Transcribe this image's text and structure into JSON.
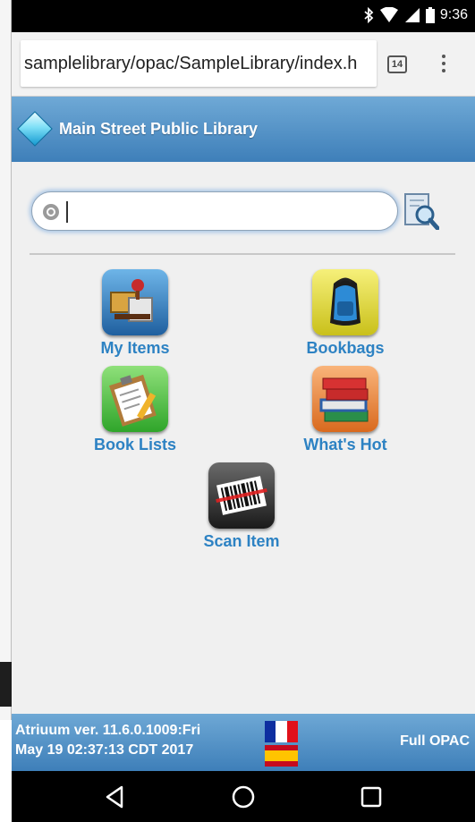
{
  "status_bar": {
    "time": "9:36",
    "icons": [
      "bluetooth-icon",
      "wifi-icon",
      "signal-icon",
      "battery-icon"
    ]
  },
  "browser": {
    "url": "samplelibrary/opac/SampleLibrary/index.h",
    "tab_count": "14"
  },
  "header": {
    "title": "Main Street Public Library"
  },
  "search": {
    "value": "",
    "placeholder": ""
  },
  "tiles": [
    {
      "label": "My Items",
      "icon": "my-items-icon"
    },
    {
      "label": "Bookbags",
      "icon": "backpack-icon"
    },
    {
      "label": "Book Lists",
      "icon": "clipboard-list-icon"
    },
    {
      "label": "What's Hot",
      "icon": "book-stack-icon"
    },
    {
      "label": "Scan Item",
      "icon": "barcode-scanner-icon"
    }
  ],
  "footer": {
    "version_line1": "Atriuum ver. 11.6.0.1009:Fri",
    "version_line2": "May 19 02:37:13 CDT 2017",
    "full_opac": "Full OPAC",
    "languages": [
      "french-flag-icon",
      "spanish-flag-icon"
    ]
  },
  "colors": {
    "header_blue": "#3e7fb9",
    "link_blue": "#2d82c3",
    "content_bg": "#f0f0f0"
  }
}
